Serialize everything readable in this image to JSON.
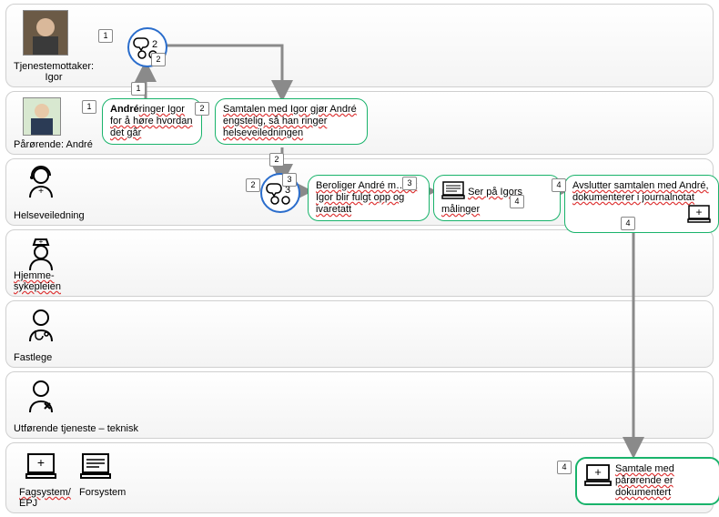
{
  "lanes": {
    "l1": {
      "label1": "Tjenestemottaker:",
      "label2": "Igor"
    },
    "l2": {
      "label1": "Pårørende:",
      "label2": "André"
    },
    "l3": {
      "label1": "Helseveiledning"
    },
    "l4": {
      "label1": "Hjemme-",
      "label2": "sykepleien"
    },
    "l5": {
      "label1": "Fastlege"
    },
    "l6": {
      "label1": "Utførende tjeneste – teknisk"
    },
    "l7": {
      "label1": "Fagsystem/",
      "label2": "EPJ",
      "label3": "Forsystem"
    }
  },
  "nodes": {
    "n1": {
      "bold": "André",
      "rest": "ringer Igor for å høre hvordan det går"
    },
    "n2": {
      "text": "Samtalen med Igor gjør André engstelig, så han ringer helseveiledningen"
    },
    "n3": {
      "text": "Beroliger André m… at Igor blir fulgt opp og ivaretatt"
    },
    "n4": {
      "text": "Ser på Igors målinger"
    },
    "n5": {
      "text": "Avslutter samtalen med André, dokumenterer i journalnotat"
    },
    "n6": {
      "text": "Samtale med pårørende er dokumentert"
    }
  },
  "badges": {
    "b1": "1",
    "b2": "1",
    "b3": "1",
    "b4": "2",
    "b5": "2",
    "b6": "2",
    "b7": "2",
    "b8": "3",
    "b9": "3",
    "b10": "4",
    "b11": "4",
    "b12": "4",
    "b13": "4"
  },
  "conv": {
    "c1": "2",
    "c2": "3"
  }
}
